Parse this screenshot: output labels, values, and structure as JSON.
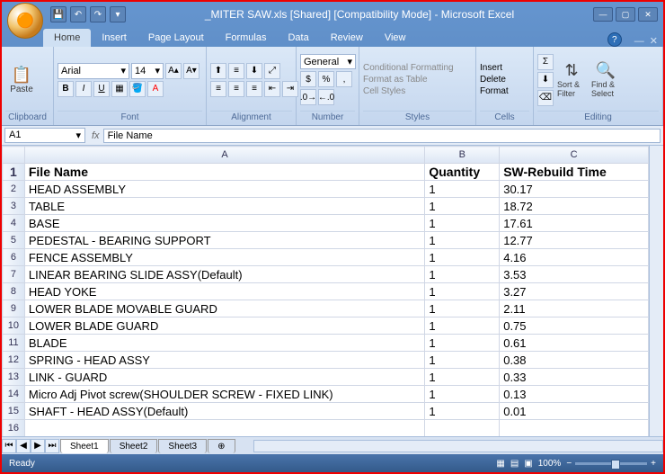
{
  "title": "_MITER SAW.xls [Shared]  [Compatibility Mode] - Microsoft Excel",
  "tabs": [
    "Home",
    "Insert",
    "Page Layout",
    "Formulas",
    "Data",
    "Review",
    "View"
  ],
  "activeTab": "Home",
  "ribbon": {
    "clipboard": {
      "label": "Clipboard",
      "paste": "Paste"
    },
    "font": {
      "label": "Font",
      "name": "Arial",
      "size": "14"
    },
    "alignment": {
      "label": "Alignment"
    },
    "number": {
      "label": "Number",
      "format": "General"
    },
    "styles": {
      "label": "Styles",
      "cond": "Conditional Formatting",
      "table": "Format as Table",
      "cell": "Cell Styles"
    },
    "cells": {
      "label": "Cells",
      "insert": "Insert",
      "delete": "Delete",
      "format": "Format"
    },
    "editing": {
      "label": "Editing",
      "sort": "Sort & Filter",
      "find": "Find & Select"
    }
  },
  "nameBox": "A1",
  "formulaBar": "File Name",
  "columns": [
    "A",
    "B",
    "C"
  ],
  "headers": {
    "A": "File Name",
    "B": "Quantity",
    "C": "SW-Rebuild Time"
  },
  "rows": [
    {
      "A": "HEAD ASSEMBLY",
      "B": "1",
      "C": "30.17"
    },
    {
      "A": "TABLE",
      "B": "1",
      "C": "18.72"
    },
    {
      "A": "BASE",
      "B": "1",
      "C": "17.61"
    },
    {
      "A": "PEDESTAL - BEARING SUPPORT",
      "B": "1",
      "C": "12.77"
    },
    {
      "A": "FENCE ASSEMBLY",
      "B": "1",
      "C": "4.16"
    },
    {
      "A": "LINEAR BEARING SLIDE ASSY(Default)",
      "B": "1",
      "C": "3.53"
    },
    {
      "A": "HEAD YOKE",
      "B": "1",
      "C": "3.27"
    },
    {
      "A": "LOWER BLADE MOVABLE GUARD",
      "B": "1",
      "C": "2.11"
    },
    {
      "A": "LOWER BLADE GUARD",
      "B": "1",
      "C": "0.75"
    },
    {
      "A": "BLADE",
      "B": "1",
      "C": "0.61"
    },
    {
      "A": "SPRING - HEAD ASSY",
      "B": "1",
      "C": "0.38"
    },
    {
      "A": "LINK - GUARD",
      "B": "1",
      "C": "0.33"
    },
    {
      "A": "Micro Adj Pivot screw(SHOULDER SCREW - FIXED LINK)",
      "B": "1",
      "C": "0.13"
    },
    {
      "A": "SHAFT - HEAD ASSY(Default)",
      "B": "1",
      "C": "0.01"
    }
  ],
  "sheetTabs": [
    "Sheet1",
    "Sheet2",
    "Sheet3"
  ],
  "status": "Ready",
  "zoom": "100%"
}
